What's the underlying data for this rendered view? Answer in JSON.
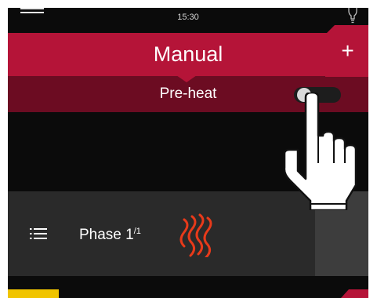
{
  "status_bar": {
    "time": "15:30"
  },
  "header": {
    "title": "Manual"
  },
  "preheat": {
    "label": "Pre-heat",
    "enabled": false
  },
  "phase": {
    "label": "Phase 1",
    "sup": "/1",
    "add_label": "+"
  },
  "colors": {
    "accent": "#b51438",
    "dark_accent": "#6c0c22",
    "panel": "#2a2a2a",
    "background": "#0b0b0b",
    "heat": "#e83a1a",
    "yellow": "#f0c400"
  },
  "icons": [
    "menu-icon",
    "lightbulb-icon",
    "list-icon",
    "heat-waves-icon",
    "hand-pointer-icon"
  ]
}
